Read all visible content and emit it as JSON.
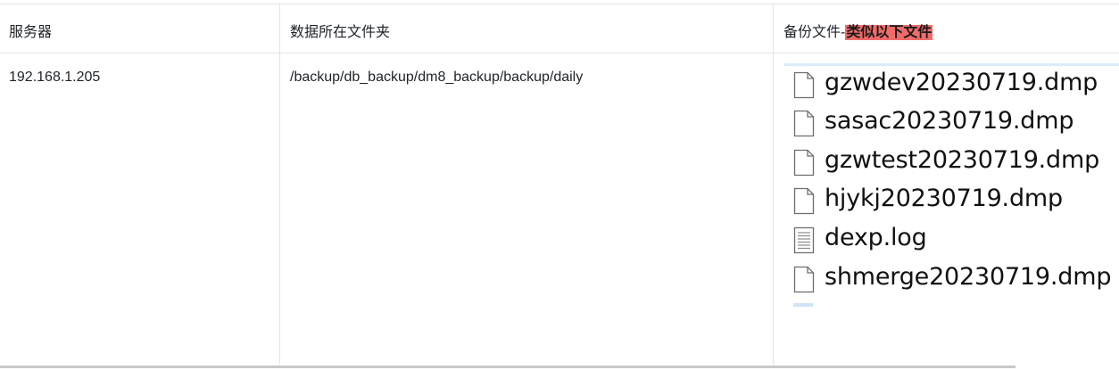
{
  "table": {
    "headers": {
      "server": "服务器",
      "data_folder": "数据所在文件夹",
      "backup_files_prefix": "备份文件-",
      "backup_files_highlight": "类似以下文件"
    },
    "rows": [
      {
        "server": "192.168.1.205",
        "data_folder": "/backup/db_backup/dm8_backup/backup/daily"
      }
    ]
  },
  "file_listing": {
    "files": [
      {
        "name": "gzwdev20230719.dmp",
        "icon": "blank-file-icon"
      },
      {
        "name": "sasac20230719.dmp",
        "icon": "blank-file-icon"
      },
      {
        "name": "gzwtest20230719.dmp",
        "icon": "blank-file-icon"
      },
      {
        "name": "hjykj20230719.dmp",
        "icon": "blank-file-icon"
      },
      {
        "name": "dexp.log",
        "icon": "text-file-icon"
      },
      {
        "name": "shmerge20230719.dmp",
        "icon": "blank-file-icon"
      }
    ]
  },
  "colors": {
    "highlight": "#f26b6b",
    "border": "#e3e3e3"
  }
}
